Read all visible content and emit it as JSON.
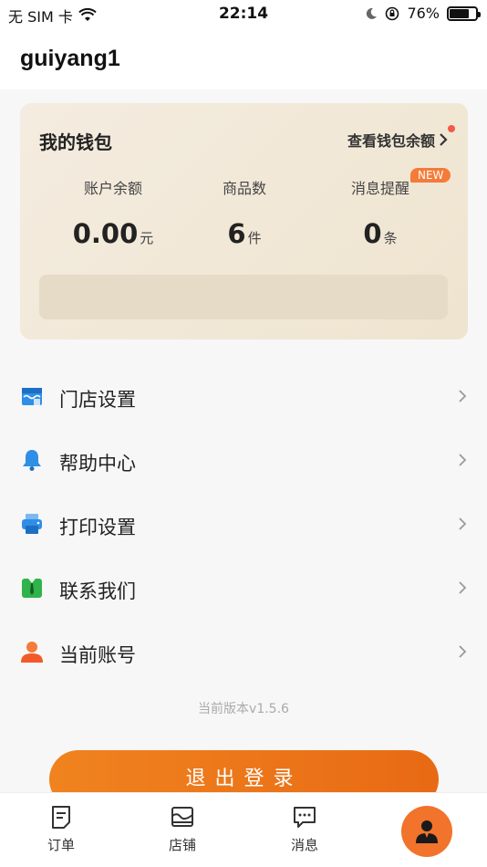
{
  "status_bar": {
    "carrier": "无 SIM 卡",
    "time": "22:14",
    "battery_percent": "76%",
    "battery_level": 0.76
  },
  "header": {
    "username": "guiyang1"
  },
  "wallet": {
    "title": "我的钱包",
    "view_balance": "查看钱包余额",
    "stats": [
      {
        "label": "账户余额",
        "value": "0.00",
        "unit": "元"
      },
      {
        "label": "商品数",
        "value": "6",
        "unit": "件"
      },
      {
        "label": "消息提醒",
        "value": "0",
        "unit": "条"
      }
    ],
    "new_badge": "NEW"
  },
  "menu": [
    {
      "label": "门店设置",
      "icon": "store-icon"
    },
    {
      "label": "帮助中心",
      "icon": "bell-icon"
    },
    {
      "label": "打印设置",
      "icon": "printer-icon"
    },
    {
      "label": "联系我们",
      "icon": "contact-icon"
    },
    {
      "label": "当前账号",
      "icon": "user-icon"
    }
  ],
  "version": "当前版本v1.5.6",
  "logout_label": "退出登录",
  "tabs": [
    {
      "label": "订单",
      "icon": "order-icon"
    },
    {
      "label": "店铺",
      "icon": "shop-icon"
    },
    {
      "label": "消息",
      "icon": "message-icon"
    }
  ],
  "colors": {
    "accent": "#f0831f",
    "wallet_bg": "#f1e7d4",
    "fab": "#f2732b"
  }
}
